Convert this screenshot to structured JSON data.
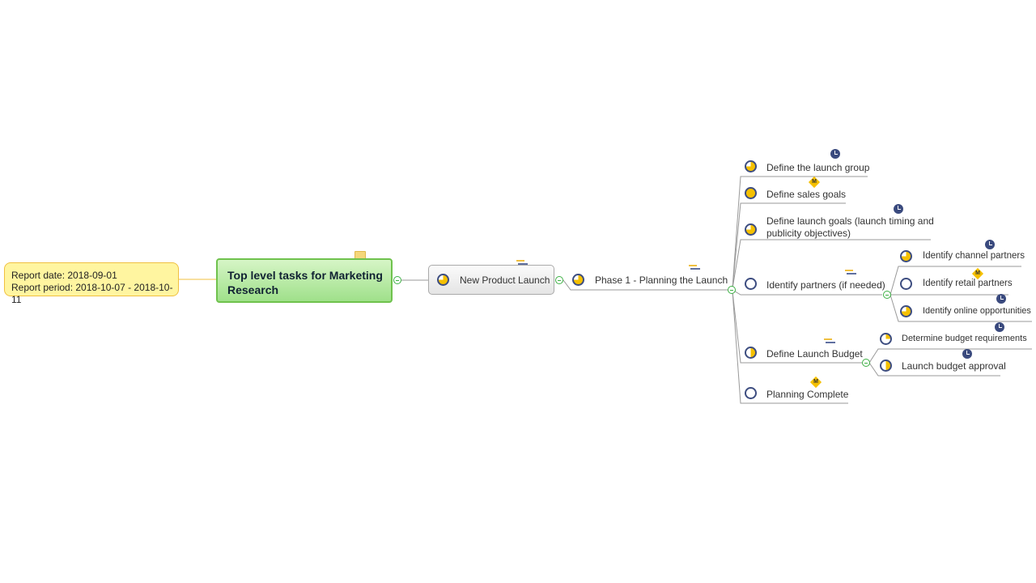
{
  "callout": {
    "line1": "Report date: 2018-09-01",
    "line2": "Report period: 2018-10-07 - 2018-10-11"
  },
  "root": {
    "title": "Top level tasks for Marketing Research",
    "icon": "folder-icon"
  },
  "colors": {
    "progress": "#f5c000",
    "ring": "#3d4d80",
    "collapse": "#3cb043",
    "rootBorder": "#6fc24d",
    "calloutFill": "#fff5a0"
  },
  "nodes": {
    "npl": {
      "label": "New Product Launch",
      "progress": 0.75
    },
    "phase1": {
      "label": "Phase 1 - Planning the Launch",
      "progress": 0.75
    },
    "t1": {
      "label": "Define the launch group",
      "progress": 0.75,
      "marker": "clock"
    },
    "t2": {
      "label": "Define sales goals",
      "progress": 1.0,
      "marker": "milestone"
    },
    "t3": {
      "label": "Define launch goals (launch timing and",
      "label2": "publicity objectives)",
      "progress": 0.75,
      "marker": "clock"
    },
    "t4": {
      "label": "Identify partners (if needed)",
      "progress": 0
    },
    "t4a": {
      "label": "Identify channel partners",
      "progress": 0.75,
      "marker": "clock"
    },
    "t4b": {
      "label": "Identify retail partners",
      "progress": 0,
      "marker": "milestone"
    },
    "t4c": {
      "label": "Identify online opportunities",
      "progress": 0.75,
      "marker": "clock"
    },
    "t5": {
      "label": "Define Launch Budget",
      "progress": 0.5
    },
    "t5a": {
      "label": "Determine budget requirements",
      "progress": 0.25,
      "marker": "clock"
    },
    "t5b": {
      "label": "Launch budget approval",
      "progress": 0.5,
      "marker": "clock"
    },
    "t6": {
      "label": "Planning Complete",
      "progress": 0,
      "marker": "milestone"
    }
  },
  "milestone_letter": "M"
}
